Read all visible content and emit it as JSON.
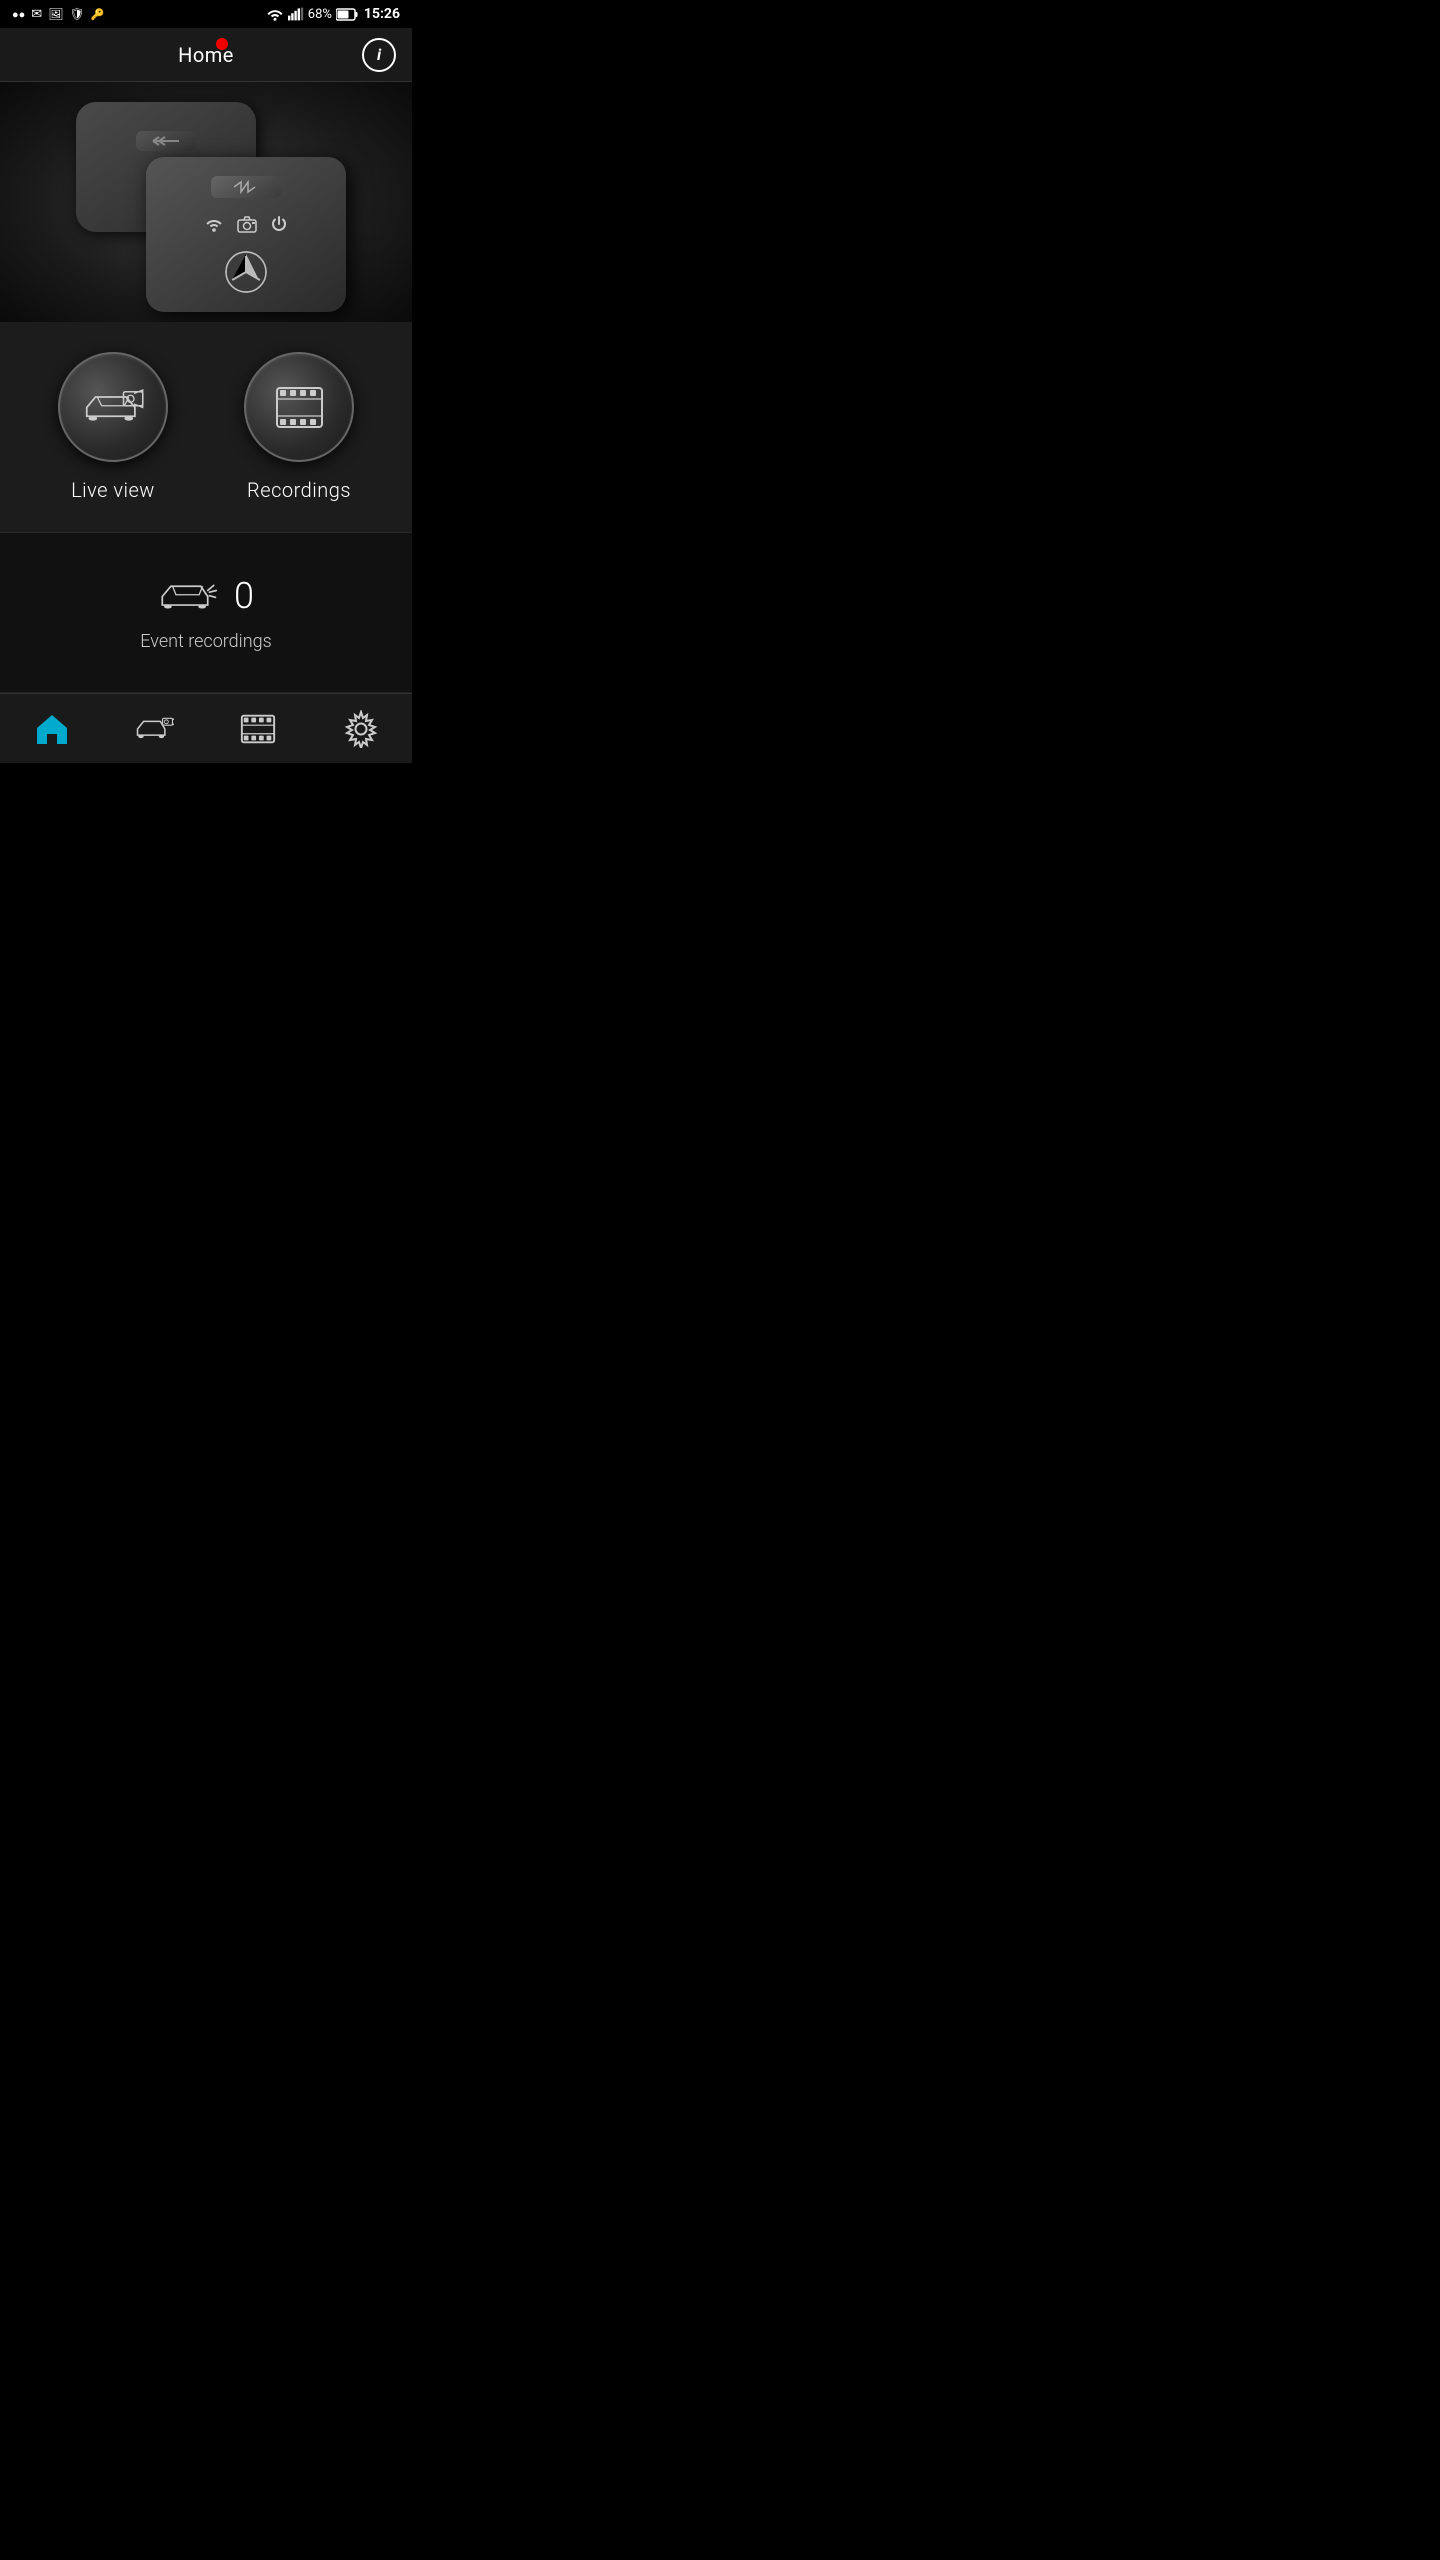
{
  "statusBar": {
    "battery": "68%",
    "time": "15:26",
    "icons": [
      "dots",
      "mail",
      "picture-mail",
      "shield",
      "key"
    ]
  },
  "header": {
    "title": "Home",
    "infoButton": "i"
  },
  "actions": {
    "liveView": {
      "label": "Live view"
    },
    "recordings": {
      "label": "Recordings"
    }
  },
  "eventSection": {
    "count": "0",
    "label": "Event recordings"
  },
  "bottomNav": {
    "items": [
      {
        "id": "home",
        "label": "Home",
        "active": true
      },
      {
        "id": "live",
        "label": "Live",
        "active": false
      },
      {
        "id": "recordings",
        "label": "Recordings",
        "active": false
      },
      {
        "id": "settings",
        "label": "Settings",
        "active": false
      }
    ]
  }
}
